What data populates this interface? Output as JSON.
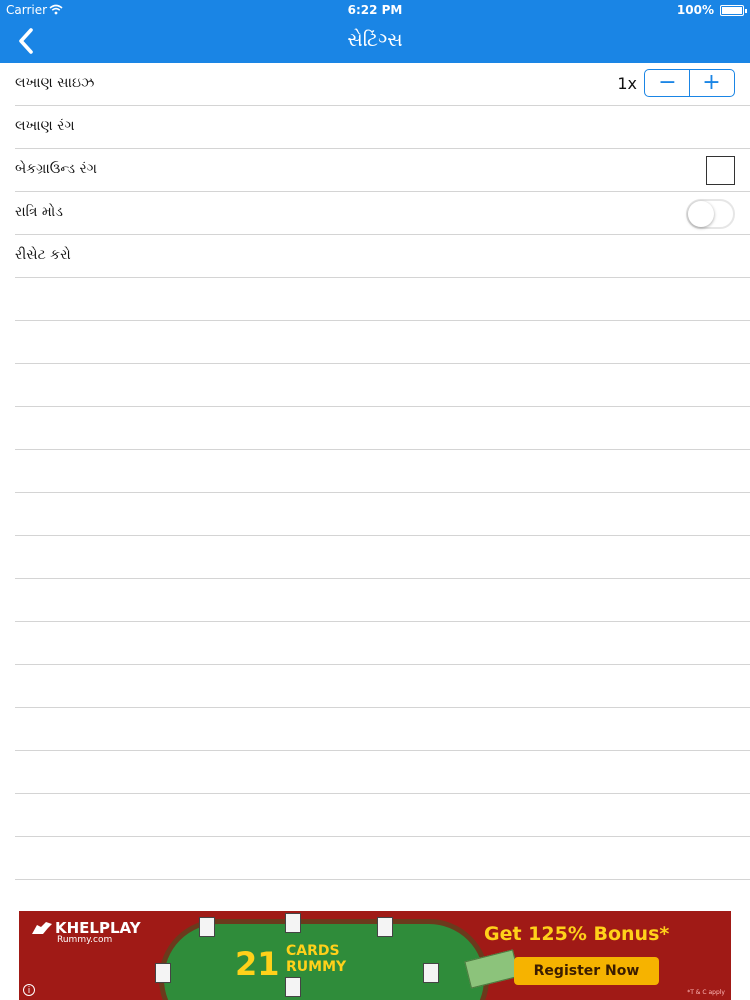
{
  "status_bar": {
    "carrier": "Carrier",
    "time": "6:22 PM",
    "battery": "100%"
  },
  "nav": {
    "title": "સેટિંગ્સ"
  },
  "settings": {
    "font_size": {
      "label": "લખાણ સાઇઝ",
      "value": "1x",
      "decrement": "−",
      "increment": "+"
    },
    "font_color": {
      "label": "લખાણ રંગ"
    },
    "background_color": {
      "label": "બેકગ્રાઉન્ડ રંગ"
    },
    "night_mode": {
      "label": "રાત્રિ મોડ",
      "on": false
    },
    "reset": {
      "label": "રીસેટ કરો"
    }
  },
  "ad": {
    "logo": "KHELPLAY",
    "logo_sub": "Rummy.com",
    "number": "21",
    "cards": "CARDS",
    "rummy": "RUMMY",
    "bonus": "Get 125% Bonus*",
    "register": "Register Now",
    "tnc": "*T & C apply",
    "info": "i"
  }
}
